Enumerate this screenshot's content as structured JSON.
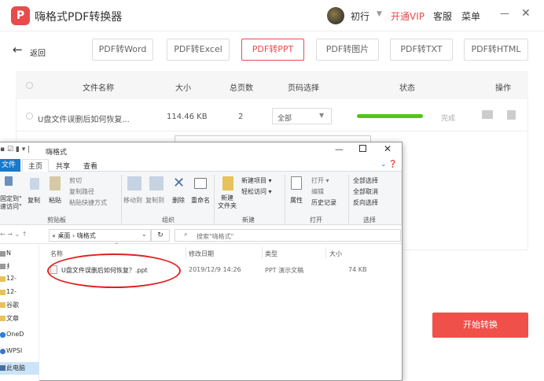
{
  "app": {
    "logo": "P",
    "title": "嗨格式PDF转换器",
    "username": "初行",
    "vip_caret": "▼",
    "vip": "开通VIP",
    "support": "客服",
    "menu": "菜单",
    "minimize": "—",
    "close": "✕"
  },
  "nav": {
    "back_arrow": "←",
    "back": "返回"
  },
  "tabs": [
    "PDF转Word",
    "PDF转Excel",
    "PDF转PPT",
    "PDF转图片",
    "PDF转TXT",
    "PDF转HTML"
  ],
  "active_tab": "PDF转PPT",
  "table": {
    "headers": {
      "name": "文件名称",
      "size": "大小",
      "pages": "总页数",
      "range": "页码选择",
      "status": "状态",
      "action": "操作"
    },
    "row": {
      "name": "U盘文件误删后如何恢复...",
      "size": "114.46 KB",
      "pages": "2",
      "range": "全部",
      "range_caret": "▼",
      "progress": 100,
      "status": "完成"
    }
  },
  "start_button": "开始转换",
  "explorer": {
    "qa": "▪ ☑ ▮ ▾ |",
    "title": "嗨格式",
    "win_min": "—",
    "win_close": "✕",
    "menus": {
      "file": "文件",
      "home": "主页",
      "share": "共享",
      "view": "查看"
    },
    "ribbon_ctrl": "⌄ ❓",
    "ribbon": {
      "pin": "固定到\"",
      "pin2": "速访问\"",
      "copy": "复制",
      "paste": "粘贴",
      "cut": "剪切",
      "copy_path": "复制路径",
      "paste_shortcut": "粘贴快捷方式",
      "move_to": "移动到",
      "copy_to": "复制到",
      "delete": "删除",
      "rename": "重命名",
      "new_folder": "新建",
      "new_folder2": "文件夹",
      "new_item": "新建项目 ▾",
      "easy_access": "轻松访问 ▾",
      "properties": "属性",
      "open": "打开 ▾",
      "edit": "编辑",
      "history": "历史记录",
      "select_all": "全部选择",
      "select_none": "全部取消",
      "invert": "反向选择"
    },
    "groups": {
      "clipboard": "剪贴板",
      "organize": "组织",
      "new": "新建",
      "open": "打开",
      "select": "选择"
    },
    "address": {
      "arrows": "← → ⌄ ↑",
      "crumbs": "« 桌面 › 嗨格式",
      "caret": "⌄",
      "refresh": "↻",
      "search_icon": "⌕",
      "search_placeholder": "搜索\"嗨格式\""
    },
    "sidebar": [
      "N",
      "扌",
      "12-",
      "12-",
      "谷歌",
      "文章",
      "OneD",
      "WPSI",
      "此电脑"
    ],
    "columns": {
      "name": "名称",
      "sort": "⌃",
      "date": "修改日期",
      "type": "类型",
      "size": "大小"
    },
    "file": {
      "name": "U盘文件误删后如何恢复？.ppt",
      "date": "2019/12/9 14:26",
      "type": "PPT 演示文稿",
      "size": "74 KB"
    }
  },
  "colors": {
    "accent": "#e84b4b",
    "progress": "#52c41a",
    "explorer_blue": "#1979ca",
    "highlight": "#e02020"
  }
}
